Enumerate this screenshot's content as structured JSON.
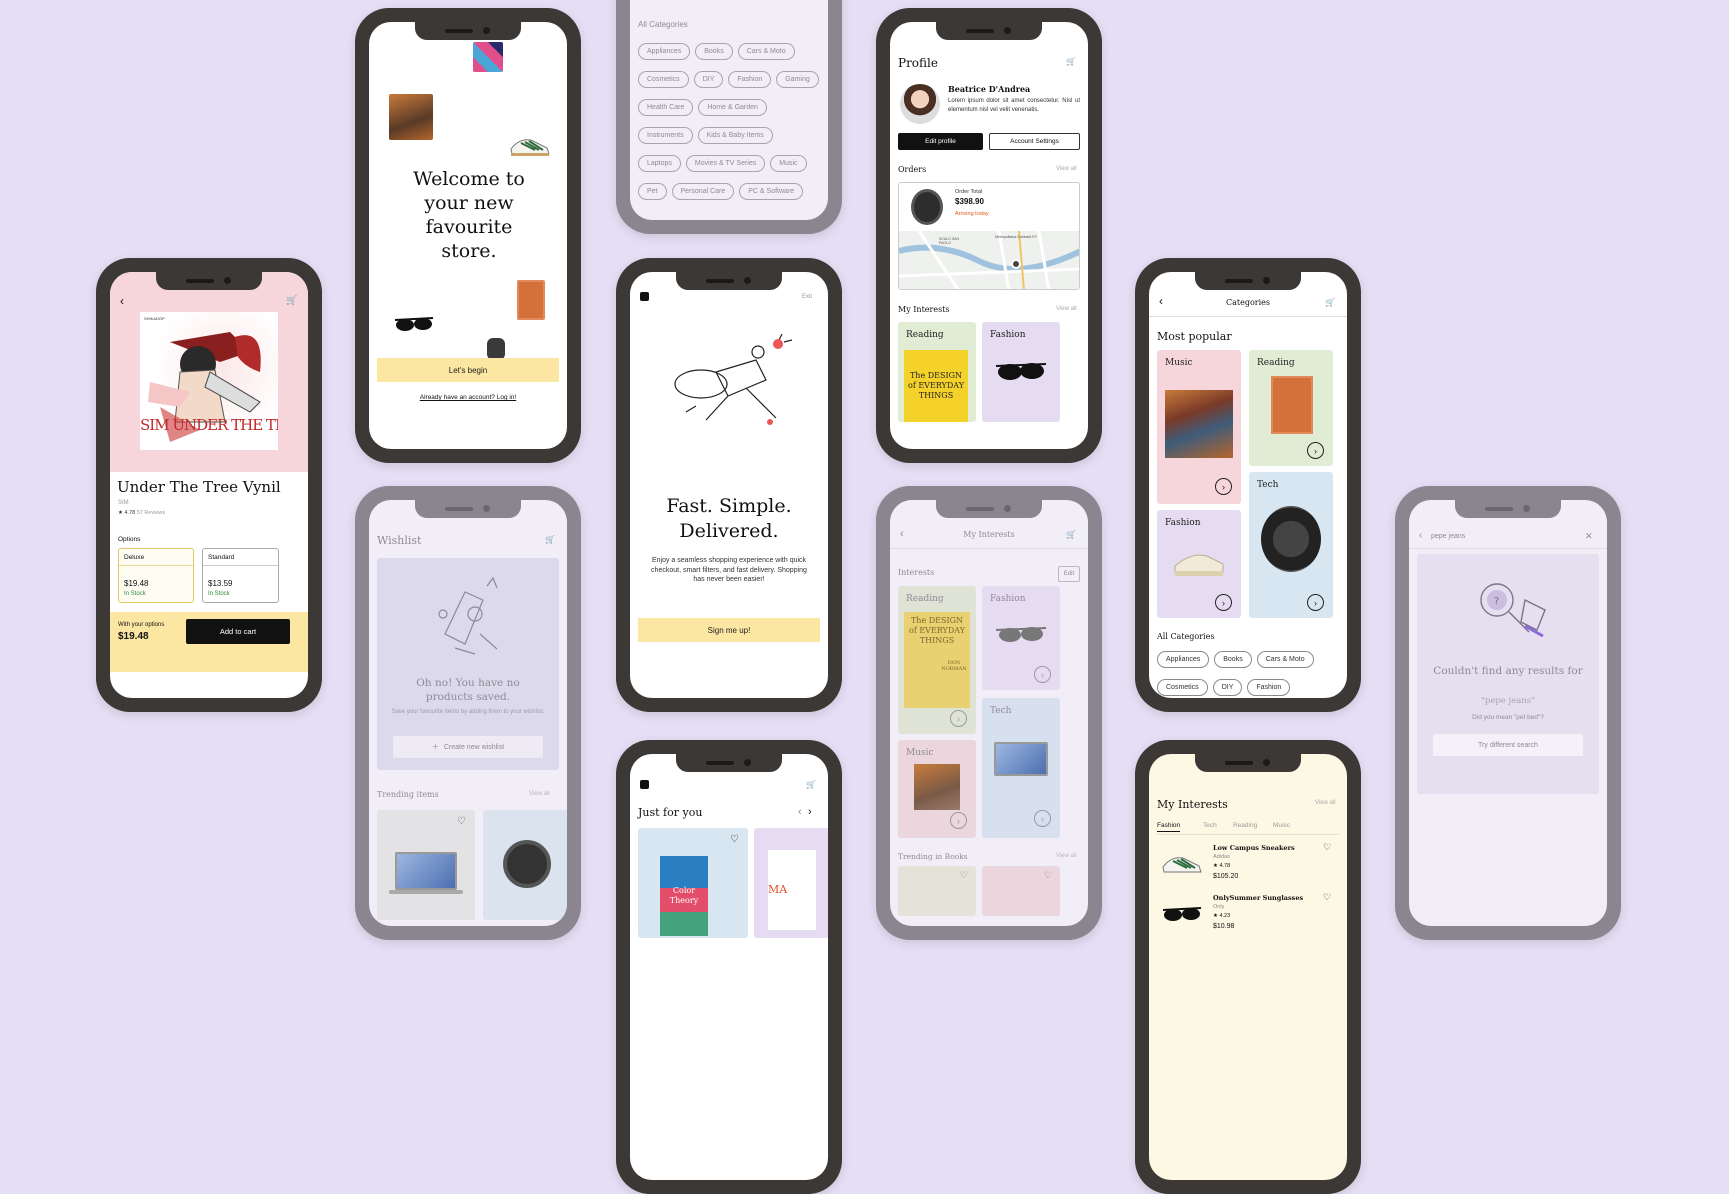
{
  "colors": {
    "background": "#e6def4",
    "pink": "#f6d6da",
    "green": "#e1ecd5",
    "lavender": "#e6dcf2",
    "blue": "#d7e6f1",
    "yellow": "#fbe6a2",
    "instock": "#2e8b3a",
    "arriving": "#e2571b"
  },
  "product": {
    "title": "Under The Tree Vynil",
    "artist": "SIM",
    "rating": "★ 4.78",
    "reviews": "57 Reviews",
    "options_label": "Options",
    "deluxe": {
      "name": "Deluxe",
      "price": "$19.48",
      "stock": "In Stock"
    },
    "standard": {
      "name": "Standard",
      "price": "$13.59",
      "stock": "In Stock"
    },
    "with_options": "With your options",
    "total": "$19.48",
    "add_to_cart": "Add to cart",
    "album_text": "SIM UNDER THE TREE",
    "album_label": "SHIKADOP"
  },
  "welcome": {
    "headline": "Welcome to your new favourite store.",
    "begin": "Let's begin",
    "login": "Already have an account? Log in!"
  },
  "wishlist": {
    "title": "Wishlist",
    "empty_title": "Oh no! You have no products saved.",
    "empty_text": "Save your favourite items by adding them to your wishlist.",
    "create": "Create new wishlist",
    "trending": "Trending items",
    "view_all": "View all"
  },
  "all_categories": {
    "title": "All Categories",
    "chips": [
      "Appliances",
      "Books",
      "Cars & Moto",
      "Cosmetics",
      "DIY",
      "Fashion",
      "Gaming",
      "Health Care",
      "Home & Garden",
      "Instruments",
      "Kids & Baby Items",
      "Laptops",
      "Movies & TV Series",
      "Music",
      "Pet",
      "Personal Care",
      "PC & Software"
    ]
  },
  "fast": {
    "exit": "Exit",
    "headline": "Fast. Simple. Delivered.",
    "text": "Enjoy a seamless shopping experience with quick checkout, smart filters, and fast delivery. Shopping has never been easier!",
    "signup": "Sign me up!"
  },
  "just": {
    "title": "Just for you",
    "book1": "Color Theory",
    "book2": "MA"
  },
  "profile": {
    "title": "Profile",
    "name": "Beatrice D'Andrea",
    "bio": "Lorem ipsum dolor sit amet consectetur. Nisl ut elementum nisl vel velit venenatis.",
    "edit": "Edit profile",
    "settings": "Account Settings",
    "orders": "Orders",
    "view_all": "View all",
    "order_total_label": "Order Total",
    "order_total": "$398.90",
    "arriving": "Arriving today",
    "map_labels": [
      "Metropolitana Garibaldi FS",
      "SCALO SAN PAOLO"
    ],
    "interests": "My Interests",
    "reading": "Reading",
    "fashion": "Fashion",
    "book_title": "The DESIGN of EVERYDAY THINGS"
  },
  "myinterests": {
    "title": "My Interests",
    "interests": "Interests",
    "edit": "Edit",
    "reading": "Reading",
    "fashion": "Fashion",
    "music": "Music",
    "tech": "Tech",
    "trending": "Trending in Books",
    "view_all": "View all",
    "book_title": "The DESIGN of EVERYDAY THINGS",
    "book_author": "DON NORMAN"
  },
  "categories": {
    "title": "Categories",
    "popular": "Most popular",
    "music": "Music",
    "reading": "Reading",
    "fashion": "Fashion",
    "tech": "Tech",
    "all": "All Categories",
    "chips": [
      "Appliances",
      "Books",
      "Cars & Moto",
      "Cosmetics",
      "DIY",
      "Fashion"
    ]
  },
  "interests2": {
    "title": "My Interests",
    "view_all": "View all",
    "tabs": [
      "Fashion",
      "Tech",
      "Reading",
      "Music"
    ],
    "items": [
      {
        "name": "Low Campus Sneakers",
        "brand": "Adidas",
        "rating": "★ 4.78",
        "price": "$105.20"
      },
      {
        "name": "OnlySummer Sunglasses",
        "brand": "Only",
        "rating": "★ 4.23",
        "price": "$10.98"
      }
    ]
  },
  "search": {
    "query": "pepe jeans",
    "title": "Couldn't find any results for",
    "query_quoted": "\"pepe jeans\"",
    "suggest": "Did you mean \"pet bed\"?",
    "retry": "Try different search"
  }
}
